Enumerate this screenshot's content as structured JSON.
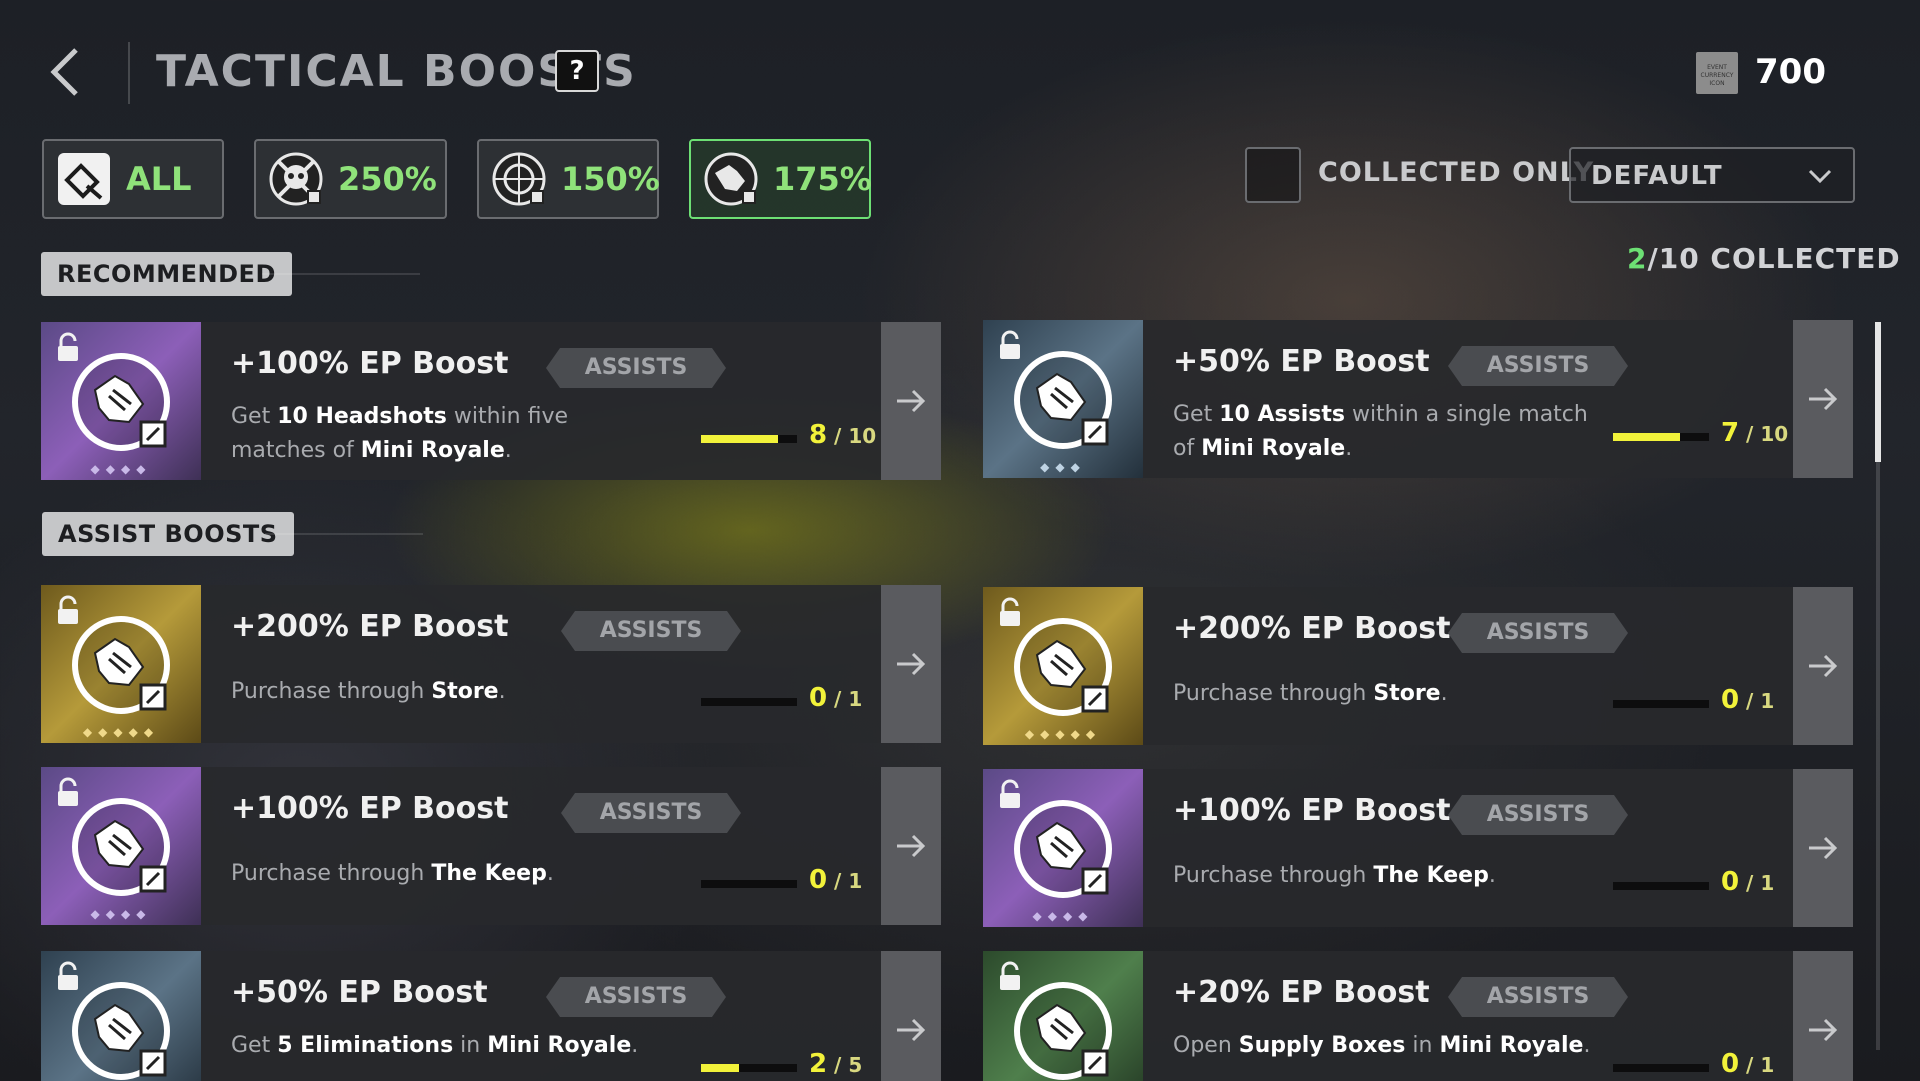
{
  "header": {
    "title": "TACTICAL BOOSTS",
    "help_label": "?",
    "currency_icon_text": "EVENT CURRENCY ICON",
    "currency_value": "700"
  },
  "filters": [
    {
      "label": "ALL",
      "icon": "all-boosts-icon",
      "active": false
    },
    {
      "label": "250%",
      "icon": "skull-eliminations-icon",
      "active": false
    },
    {
      "label": "150%",
      "icon": "headshot-target-icon",
      "active": false
    },
    {
      "label": "175%",
      "icon": "handshake-assists-icon",
      "active": true
    }
  ],
  "controls": {
    "collected_only_label": "COLLECTED ONLY",
    "collected_only_checked": false,
    "sort_value": "DEFAULT",
    "collected_num": "2",
    "collected_rest": "/10 COLLECTED"
  },
  "sections": {
    "recommended": "RECOMMENDED",
    "assist_boosts": "ASSIST BOOSTS"
  },
  "colors": {
    "accent_green": "#6de074",
    "progress_yellow": "#f2f23a"
  },
  "cards": [
    {
      "name": "+100% EP Boost",
      "tag": "ASSISTS",
      "rarity": "purple",
      "desc": [
        [
          "Get ",
          false
        ],
        [
          "10 Headshots",
          true
        ],
        [
          " within five matches of ",
          false
        ],
        [
          "Mini Royale",
          true
        ],
        [
          ".",
          false
        ]
      ],
      "current": "8",
      "total": "10",
      "progress": 0.8
    },
    {
      "name": "+50% EP Boost",
      "tag": "ASSISTS",
      "rarity": "blue",
      "desc": [
        [
          "Get ",
          false
        ],
        [
          "10 Assists",
          true
        ],
        [
          " within a single match of ",
          false
        ],
        [
          "Mini Royale",
          true
        ],
        [
          ".",
          false
        ]
      ],
      "current": "7",
      "total": "10",
      "progress": 0.7
    },
    {
      "name": "+200% EP Boost",
      "tag": "ASSISTS",
      "rarity": "gold",
      "desc": [
        [
          "Purchase through ",
          false
        ],
        [
          "Store",
          true
        ],
        [
          ".",
          false
        ]
      ],
      "current": "0",
      "total": "1",
      "progress": 0
    },
    {
      "name": "+200% EP Boost",
      "tag": "ASSISTS",
      "rarity": "gold",
      "desc": [
        [
          "Purchase through ",
          false
        ],
        [
          "Store",
          true
        ],
        [
          ".",
          false
        ]
      ],
      "current": "0",
      "total": "1",
      "progress": 0
    },
    {
      "name": "+100% EP Boost",
      "tag": "ASSISTS",
      "rarity": "purple",
      "desc": [
        [
          "Purchase through ",
          false
        ],
        [
          "The Keep",
          true
        ],
        [
          ".",
          false
        ]
      ],
      "current": "0",
      "total": "1",
      "progress": 0
    },
    {
      "name": "+100% EP Boost",
      "tag": "ASSISTS",
      "rarity": "purple",
      "desc": [
        [
          "Purchase through ",
          false
        ],
        [
          "The Keep",
          true
        ],
        [
          ".",
          false
        ]
      ],
      "current": "0",
      "total": "1",
      "progress": 0
    },
    {
      "name": "+50% EP Boost",
      "tag": "ASSISTS",
      "rarity": "blue",
      "desc": [
        [
          "Get ",
          false
        ],
        [
          "5 Eliminations",
          true
        ],
        [
          " in ",
          false
        ],
        [
          "Mini Royale",
          true
        ],
        [
          ".",
          false
        ]
      ],
      "current": "2",
      "total": "5",
      "progress": 0.4
    },
    {
      "name": "+20% EP Boost",
      "tag": "ASSISTS",
      "rarity": "green",
      "desc": [
        [
          "Open ",
          false
        ],
        [
          "Supply Boxes",
          true
        ],
        [
          " in ",
          false
        ],
        [
          "Mini Royale",
          true
        ],
        [
          ".",
          false
        ]
      ],
      "current": "0",
      "total": "1",
      "progress": 0
    }
  ]
}
